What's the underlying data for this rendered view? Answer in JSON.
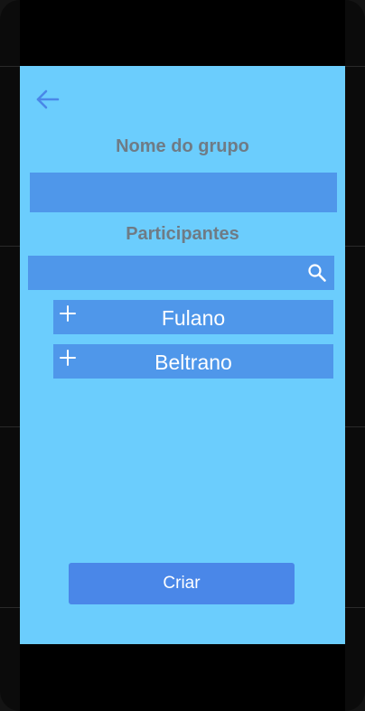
{
  "header": {
    "back_icon": "arrow-left-icon"
  },
  "group_name": {
    "label": "Nome do grupo",
    "value": "",
    "placeholder": ""
  },
  "participants": {
    "label": "Participantes",
    "search_value": "",
    "search_placeholder": "",
    "search_icon": "search-icon",
    "add_icon": "plus-icon",
    "items": [
      {
        "name": "Fulano"
      },
      {
        "name": "Beltrano"
      }
    ]
  },
  "actions": {
    "create_label": "Criar"
  },
  "colors": {
    "screen_bg": "#6bcdfd",
    "field_bg": "#4f97ea",
    "button_bg": "#4a87e8",
    "label_text": "#6f7b85",
    "icon_accent": "#4a87e8"
  }
}
